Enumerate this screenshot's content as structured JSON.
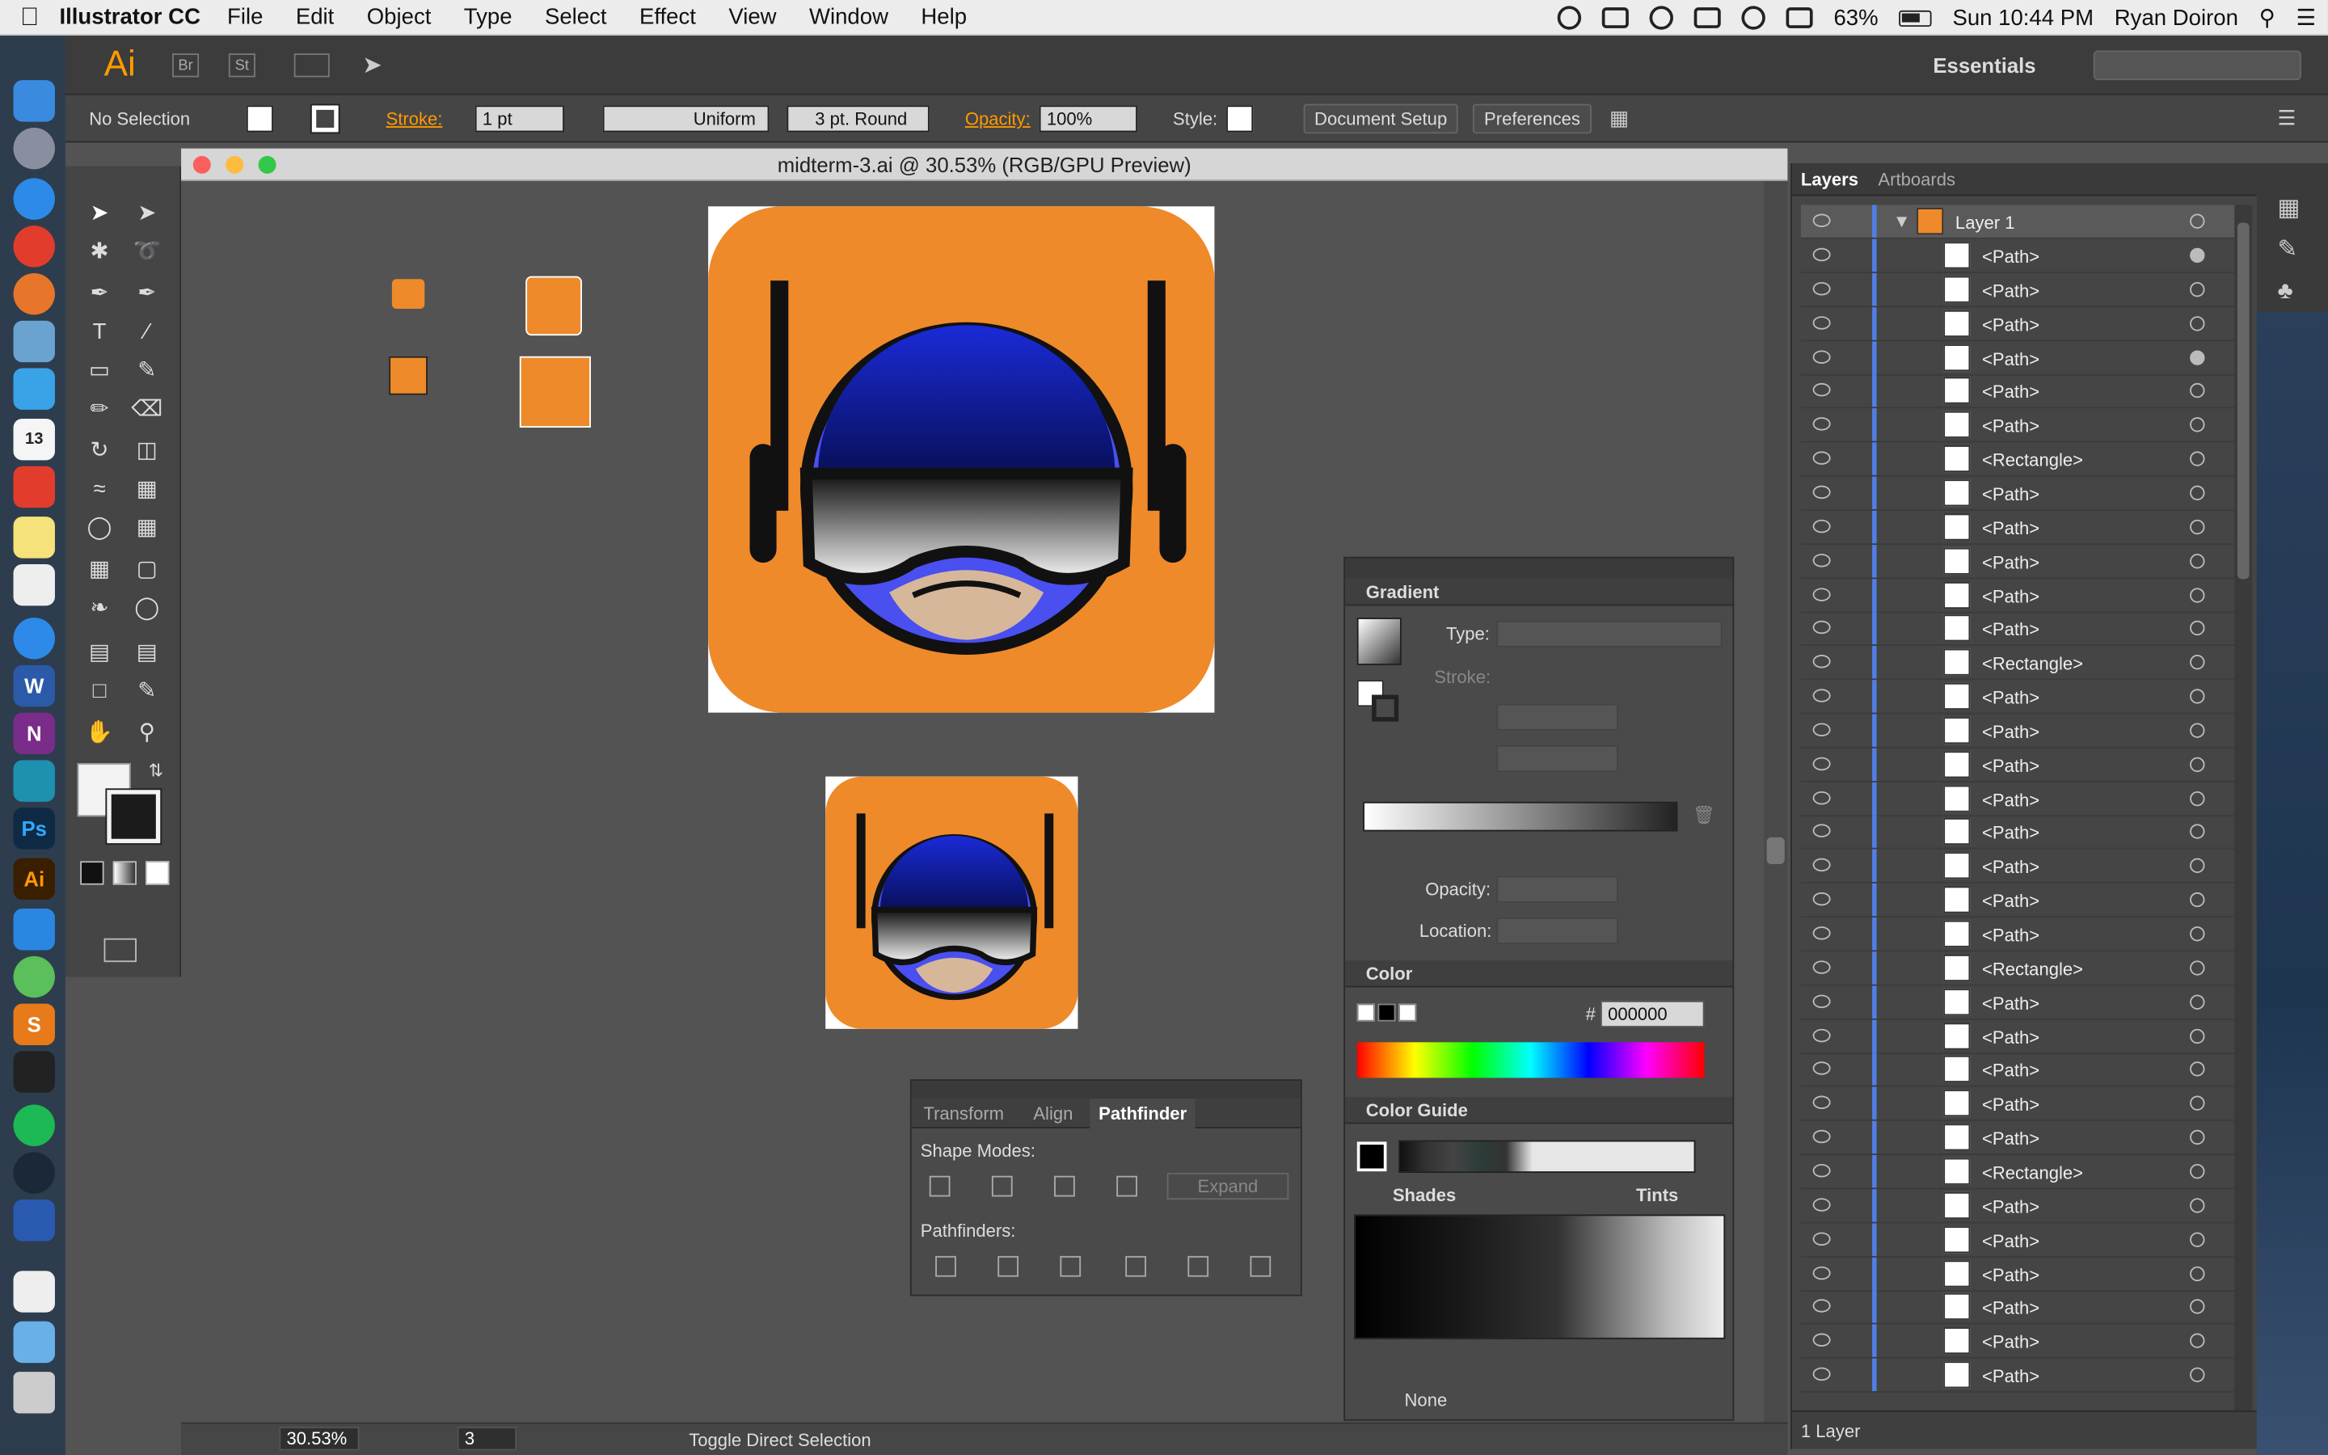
{
  "menubar": {
    "app_name": "Illustrator CC",
    "items": [
      "File",
      "Edit",
      "Object",
      "Type",
      "Select",
      "Effect",
      "View",
      "Window",
      "Help"
    ],
    "battery": "63%",
    "clock": "Sun 10:44 PM",
    "user": "Ryan Doiron"
  },
  "appbar": {
    "logo": "Ai",
    "bridge": "Br",
    "stock": "St",
    "workspace": "Essentials"
  },
  "control": {
    "selection": "No Selection",
    "stroke_label": "Stroke:",
    "stroke_weight": "1 pt",
    "profile": "Uniform",
    "brush": "3 pt. Round",
    "opacity_label": "Opacity:",
    "opacity": "100%",
    "style_label": "Style:",
    "document_setup": "Document Setup",
    "preferences": "Preferences"
  },
  "document": {
    "title": "midterm-3.ai @ 30.53% (RGB/GPU Preview)",
    "zoom": "30.53%",
    "artboard_num": "3",
    "status_text": "Toggle Direct Selection"
  },
  "gradient": {
    "title": "Gradient",
    "type_label": "Type:",
    "stroke_label": "Stroke:",
    "opacity_label": "Opacity:",
    "location_label": "Location:"
  },
  "color": {
    "title": "Color",
    "hash": "#",
    "hex": "000000"
  },
  "color_guide": {
    "title": "Color Guide",
    "shades": "Shades",
    "tints": "Tints",
    "none": "None"
  },
  "pathfinder": {
    "tabs": [
      "Transform",
      "Align",
      "Pathfinder"
    ],
    "shape_modes": "Shape Modes:",
    "expand": "Expand",
    "pathfinders": "Pathfinders:"
  },
  "layers": {
    "tabs": [
      "Layers",
      "Artboards"
    ],
    "layer_name": "Layer 1",
    "footer": "1 Layer",
    "items": [
      {
        "name": "<Path>",
        "target_on": true
      },
      {
        "name": "<Path>",
        "target_on": false
      },
      {
        "name": "<Path>",
        "target_on": false
      },
      {
        "name": "<Path>",
        "target_on": true
      },
      {
        "name": "<Path>",
        "target_on": false
      },
      {
        "name": "<Path>",
        "target_on": false
      },
      {
        "name": "<Rectangle>",
        "target_on": false
      },
      {
        "name": "<Path>",
        "target_on": false
      },
      {
        "name": "<Path>",
        "target_on": false
      },
      {
        "name": "<Path>",
        "target_on": false
      },
      {
        "name": "<Path>",
        "target_on": false
      },
      {
        "name": "<Path>",
        "target_on": false
      },
      {
        "name": "<Rectangle>",
        "target_on": false
      },
      {
        "name": "<Path>",
        "target_on": false
      },
      {
        "name": "<Path>",
        "target_on": false
      },
      {
        "name": "<Path>",
        "target_on": false
      },
      {
        "name": "<Path>",
        "target_on": false
      },
      {
        "name": "<Path>",
        "target_on": false
      },
      {
        "name": "<Path>",
        "target_on": false
      },
      {
        "name": "<Path>",
        "target_on": false
      },
      {
        "name": "<Path>",
        "target_on": false
      },
      {
        "name": "<Rectangle>",
        "target_on": false
      },
      {
        "name": "<Path>",
        "target_on": false
      },
      {
        "name": "<Path>",
        "target_on": false
      },
      {
        "name": "<Path>",
        "target_on": false
      },
      {
        "name": "<Path>",
        "target_on": false
      },
      {
        "name": "<Path>",
        "target_on": false
      },
      {
        "name": "<Rectangle>",
        "target_on": false
      },
      {
        "name": "<Path>",
        "target_on": false
      },
      {
        "name": "<Path>",
        "target_on": false
      },
      {
        "name": "<Path>",
        "target_on": false
      },
      {
        "name": "<Path>",
        "target_on": false
      },
      {
        "name": "<Path>",
        "target_on": false
      },
      {
        "name": "<Path>",
        "target_on": false
      }
    ]
  },
  "colors": {
    "accent_orange": "#ff9a00",
    "icon_orange": "#ee8a2a",
    "helmet_blue": "#1a2bd8",
    "layer_bar": "#4f7fe6"
  },
  "icons": [
    "apple-icon",
    "creative-cloud-icon",
    "dropbox-icon",
    "wifi-icon",
    "volume-icon",
    "battery-icon",
    "search-icon",
    "menu-list-icon",
    "eye-icon",
    "target-icon",
    "lock-icon"
  ]
}
